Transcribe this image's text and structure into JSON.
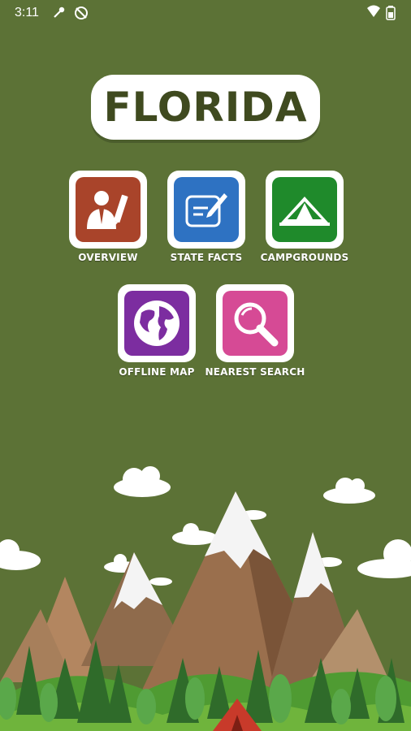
{
  "status_bar": {
    "time": "3:11"
  },
  "app": {
    "title": "FLORIDA"
  },
  "menu": {
    "overview": {
      "label": "OVERVIEW",
      "color": "#a9442a"
    },
    "state_facts": {
      "label": "STATE FACTS",
      "color": "#2e72c2"
    },
    "campgrounds": {
      "label": "CAMPGROUNDS",
      "color": "#1f8a2b"
    },
    "offline_map": {
      "label": "OFFLINE MAP",
      "color": "#7c2da0"
    },
    "nearest_search": {
      "label": "NEAREST SEARCH",
      "color": "#d64a95"
    }
  },
  "colors": {
    "background": "#5c7236",
    "title_text": "#3f4a1f"
  }
}
